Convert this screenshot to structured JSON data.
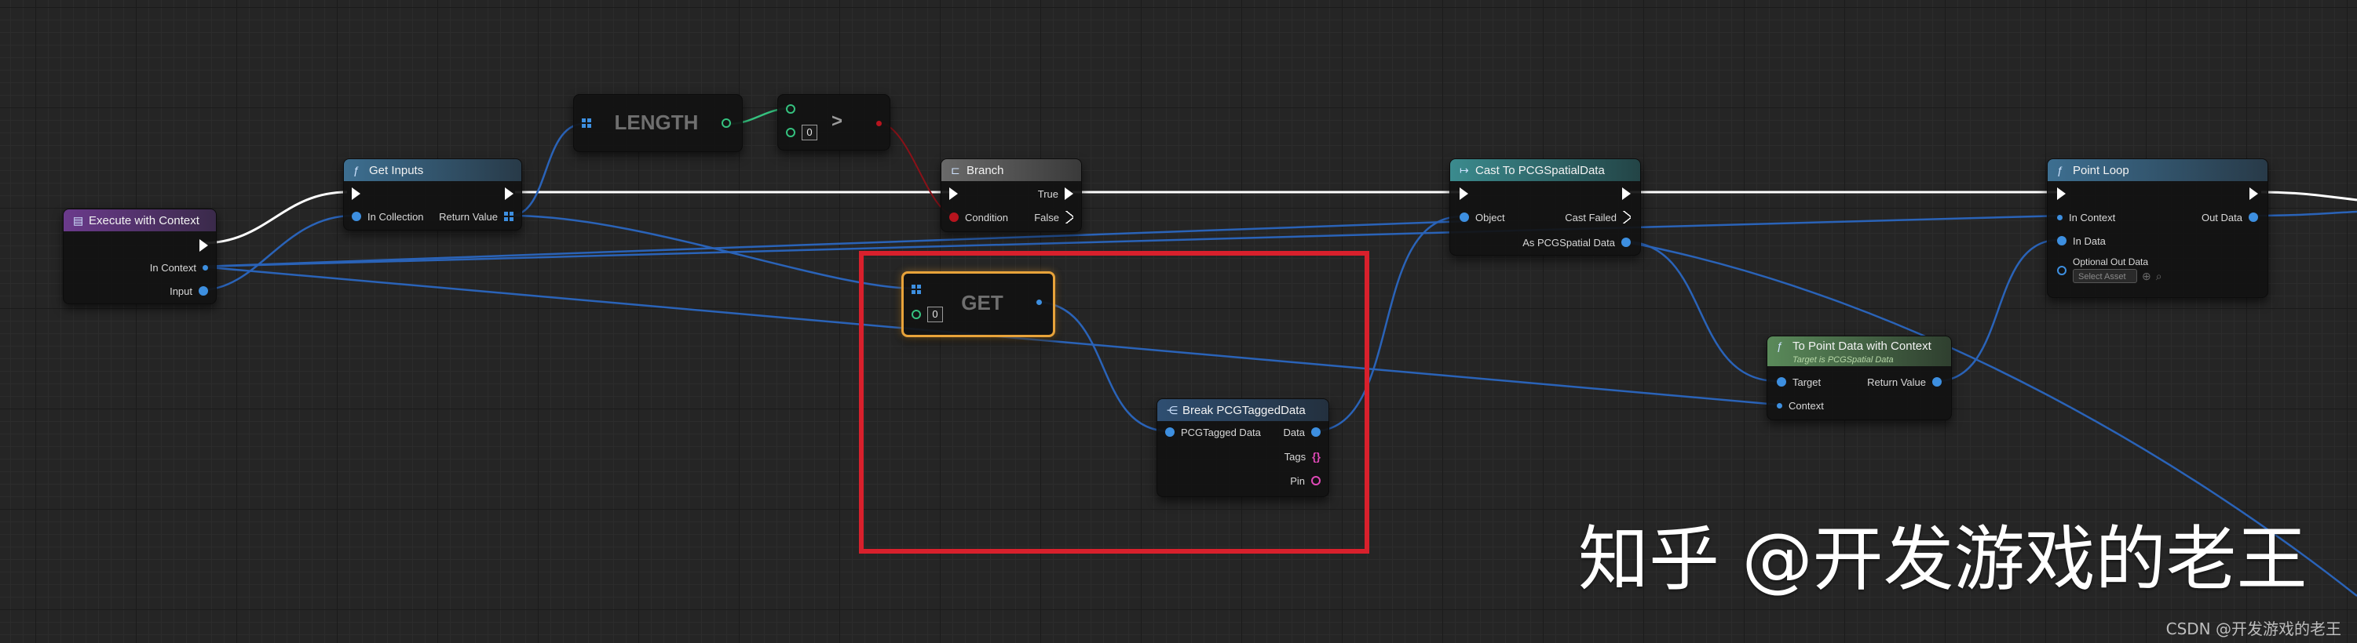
{
  "nodes": {
    "execute_with_context": {
      "title": "Execute with Context",
      "pins": {
        "in_context": "In Context",
        "input": "Input"
      }
    },
    "get_inputs": {
      "title": "Get Inputs",
      "pins": {
        "in_collection": "In Collection",
        "return_value": "Return Value"
      }
    },
    "length": {
      "title": "LENGTH"
    },
    "greater": {
      "symbol": ">",
      "default_value": "0"
    },
    "branch": {
      "title": "Branch",
      "pins": {
        "condition": "Condition",
        "true": "True",
        "false": "False"
      }
    },
    "get": {
      "title": "GET",
      "default_index": "0"
    },
    "break_tagged_data": {
      "title": "Break PCGTaggedData",
      "pins": {
        "tagged_data": "PCGTagged Data",
        "data": "Data",
        "tags": "Tags",
        "pin": "Pin"
      }
    },
    "cast_spatial": {
      "title": "Cast To PCGSpatialData",
      "pins": {
        "object": "Object",
        "cast_failed": "Cast Failed",
        "as_spatial": "As PCGSpatial Data"
      }
    },
    "to_point_data": {
      "title": "To Point Data with Context",
      "subtitle": "Target is PCGSpatial Data",
      "pins": {
        "target": "Target",
        "context": "Context",
        "return_value": "Return Value"
      }
    },
    "point_loop": {
      "title": "Point Loop",
      "pins": {
        "in_context": "In Context",
        "in_data": "In Data",
        "optional_out_data": "Optional Out Data",
        "out_data": "Out Data"
      },
      "asset_placeholder": "Select Asset"
    }
  },
  "overlay": {
    "watermark": "知乎 @开发游戏的老王",
    "credit": "CSDN @开发游戏的老王"
  },
  "colors": {
    "function_header": "#3d6f91",
    "event_header": "#6b3a8c",
    "branch_header": "#6a6a6a",
    "cast_header": "#3b8b8e",
    "context_header": "#5a8a5a",
    "struct_pin": "#3d8fe0",
    "int_pin": "#35c27f",
    "bool_pin": "#b7141e",
    "highlight_box": "#d8202c",
    "selected_outline": "#e8a33a"
  }
}
